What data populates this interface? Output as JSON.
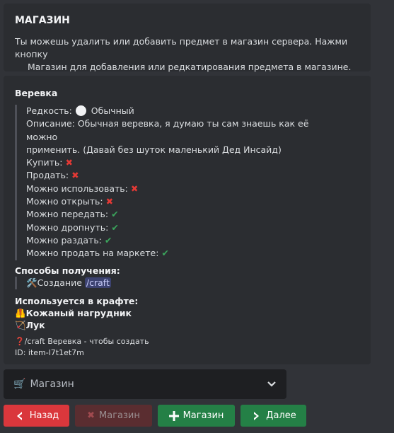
{
  "header_embed": {
    "title": "МАГАЗИН",
    "desc_line1": "Ты можешь удалить или добавить предмет в магазин сервера. Нажми кнопку",
    "desc_line2": "Магазин для добавления или редкатирования предмета в магазине."
  },
  "item_embed": {
    "title": "Веревка",
    "rarity_label": "Редкость:",
    "rarity_value": "Обычный",
    "description_line1": "Описание: Обычная веревка, я думаю ты сам знаешь как её можно",
    "description_line2": "применить. (Давай без шуток маленький Дед Инсайд)",
    "properties": [
      {
        "label": "Купить:",
        "value": false
      },
      {
        "label": "Продать:",
        "value": false
      },
      {
        "label": "Можно использовать:",
        "value": false
      },
      {
        "label": "Можно открыть:",
        "value": false
      },
      {
        "label": "Можно передать:",
        "value": true
      },
      {
        "label": "Можно дропнуть:",
        "value": true
      },
      {
        "label": "Можно раздать:",
        "value": true
      },
      {
        "label": "Можно продать на маркете:",
        "value": true
      }
    ],
    "obtain_title": "Способы получения:",
    "obtain_text": "Создание",
    "obtain_cmd": "/craft",
    "used_title": "Используется в крафте:",
    "used_items": [
      "Кожаный нагрудник",
      "Лук"
    ],
    "craft_hint": "/craft Веревка - чтобы создать",
    "id_text": "ID: item-l7t1et7m"
  },
  "select": {
    "label": "Магазин"
  },
  "buttons": {
    "back": "Назад",
    "shop_disabled": "Магазин",
    "shop_add": "Магазин",
    "next": "Далее"
  },
  "icons": {
    "cross": "✖",
    "check": "✔",
    "obtain": "hammer-wrench-icon",
    "cart": "cart-icon"
  },
  "colors": {
    "red": "#da373c",
    "green": "#248046",
    "cross": "#e53935",
    "check": "#3ba55c"
  }
}
